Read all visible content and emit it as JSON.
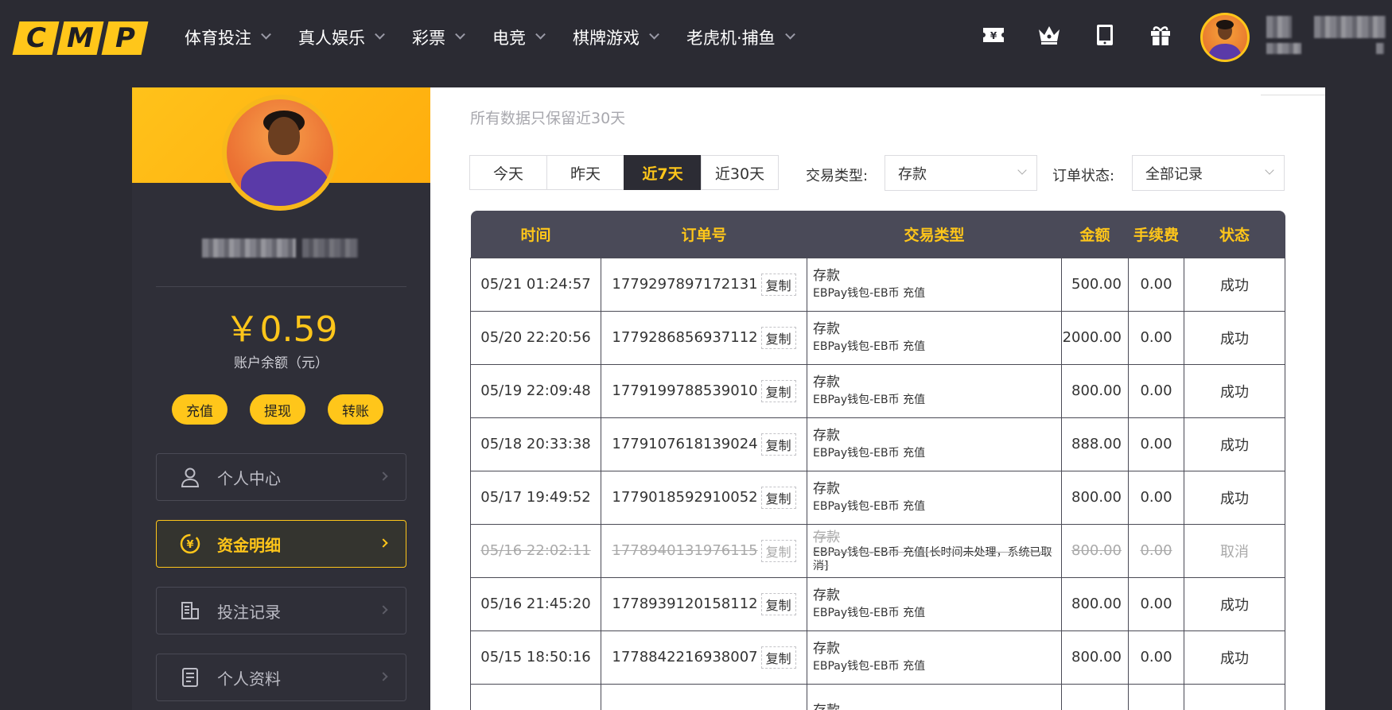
{
  "header": {
    "logo": [
      "C",
      "M",
      "P"
    ],
    "nav": [
      {
        "label": "体育投注"
      },
      {
        "label": "真人娱乐"
      },
      {
        "label": "彩票"
      },
      {
        "label": "电竞"
      },
      {
        "label": "棋牌游戏"
      },
      {
        "label": "老虎机·捕鱼"
      }
    ],
    "icons": [
      "ticket-icon",
      "crown-icon",
      "tablet-icon",
      "gift-icon"
    ]
  },
  "sidebar": {
    "balance": "￥0.59",
    "balance_label": "账户余额（元）",
    "buttons": {
      "deposit": "充值",
      "withdraw": "提现",
      "transfer": "转账"
    },
    "menu": [
      {
        "label": "个人中心",
        "icon": "user-icon",
        "active": false
      },
      {
        "label": "资金明细",
        "icon": "yen-circle-icon",
        "active": true
      },
      {
        "label": "投注记录",
        "icon": "bet-record-icon",
        "active": false
      },
      {
        "label": "个人资料",
        "icon": "profile-doc-icon",
        "active": false
      }
    ]
  },
  "main": {
    "subtitle": "所有数据只保留近30天",
    "date_tabs": [
      {
        "label": "今天",
        "active": false
      },
      {
        "label": "昨天",
        "active": false
      },
      {
        "label": "近7天",
        "active": true
      },
      {
        "label": "近30天",
        "active": false
      }
    ],
    "filters": {
      "type_label": "交易类型:",
      "type_value": "存款",
      "status_label": "订单状态:",
      "status_value": "全部记录"
    },
    "table": {
      "headers": [
        "时间",
        "订单号",
        "交易类型",
        "金额",
        "手续费",
        "状态"
      ],
      "copy_label": "复制",
      "rows": [
        {
          "time": "05/21 01:24:57",
          "order": "1779297897172131",
          "type": "存款",
          "detail": "EBPay钱包-EB币 充值",
          "amount": "500.00",
          "fee": "0.00",
          "status": "成功",
          "cancelled": false
        },
        {
          "time": "05/20 22:20:56",
          "order": "1779286856937112",
          "type": "存款",
          "detail": "EBPay钱包-EB币 充值",
          "amount": "2000.00",
          "fee": "0.00",
          "status": "成功",
          "cancelled": false
        },
        {
          "time": "05/19 22:09:48",
          "order": "1779199788539010",
          "type": "存款",
          "detail": "EBPay钱包-EB币 充值",
          "amount": "800.00",
          "fee": "0.00",
          "status": "成功",
          "cancelled": false
        },
        {
          "time": "05/18 20:33:38",
          "order": "1779107618139024",
          "type": "存款",
          "detail": "EBPay钱包-EB币 充值",
          "amount": "888.00",
          "fee": "0.00",
          "status": "成功",
          "cancelled": false
        },
        {
          "time": "05/17 19:49:52",
          "order": "1779018592910052",
          "type": "存款",
          "detail": "EBPay钱包-EB币 充值",
          "amount": "800.00",
          "fee": "0.00",
          "status": "成功",
          "cancelled": false
        },
        {
          "time": "05/16 22:02:11",
          "order": "1778940131976115",
          "type": "存款",
          "detail": "EBPay钱包-EB币 充值[长时间未处理，系统已取消]",
          "amount": "800.00",
          "fee": "0.00",
          "status": "取消",
          "cancelled": true
        },
        {
          "time": "05/16 21:45:20",
          "order": "1778939120158112",
          "type": "存款",
          "detail": "EBPay钱包-EB币 充值",
          "amount": "800.00",
          "fee": "0.00",
          "status": "成功",
          "cancelled": false
        },
        {
          "time": "05/15 18:50:16",
          "order": "1778842216938007",
          "type": "存款",
          "detail": "EBPay钱包-EB币 充值",
          "amount": "800.00",
          "fee": "0.00",
          "status": "成功",
          "cancelled": false
        },
        {
          "time": "",
          "order": "",
          "type": "存款",
          "detail": "",
          "amount": "",
          "fee": "",
          "status": "",
          "cancelled": false
        }
      ]
    }
  }
}
